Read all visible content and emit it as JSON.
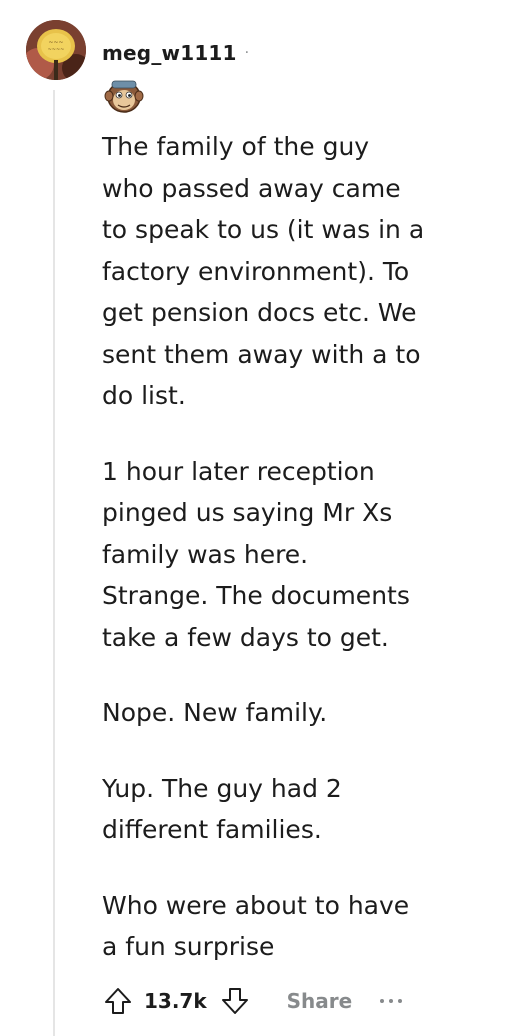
{
  "comment": {
    "author": "meg_w1111",
    "separator": "·",
    "paragraphs": [
      "The family of the guy\nwho passed away came\nto speak to us (it was in a\nfactory environment). To\nget pension docs etc. We\nsent them away with a to\ndo list.",
      "1 hour later reception\npinged us saying Mr Xs\nfamily was here.\nStrange. The documents\ntake a few days to get.",
      "Nope. New family.",
      "Yup. The guy had 2\ndifferent families.",
      "Who were about to have\na fun surprise"
    ],
    "score": "13.7k",
    "share_label": "Share"
  },
  "icons": {
    "avatar": "user-avatar",
    "flair": "monkey-flair-icon",
    "upvote": "upvote-arrow-icon",
    "downvote": "downvote-arrow-icon",
    "more": "more-options-icon"
  },
  "colors": {
    "text": "#1c1c1c",
    "muted": "#878a8c",
    "thread_line": "#e5e5e5"
  }
}
